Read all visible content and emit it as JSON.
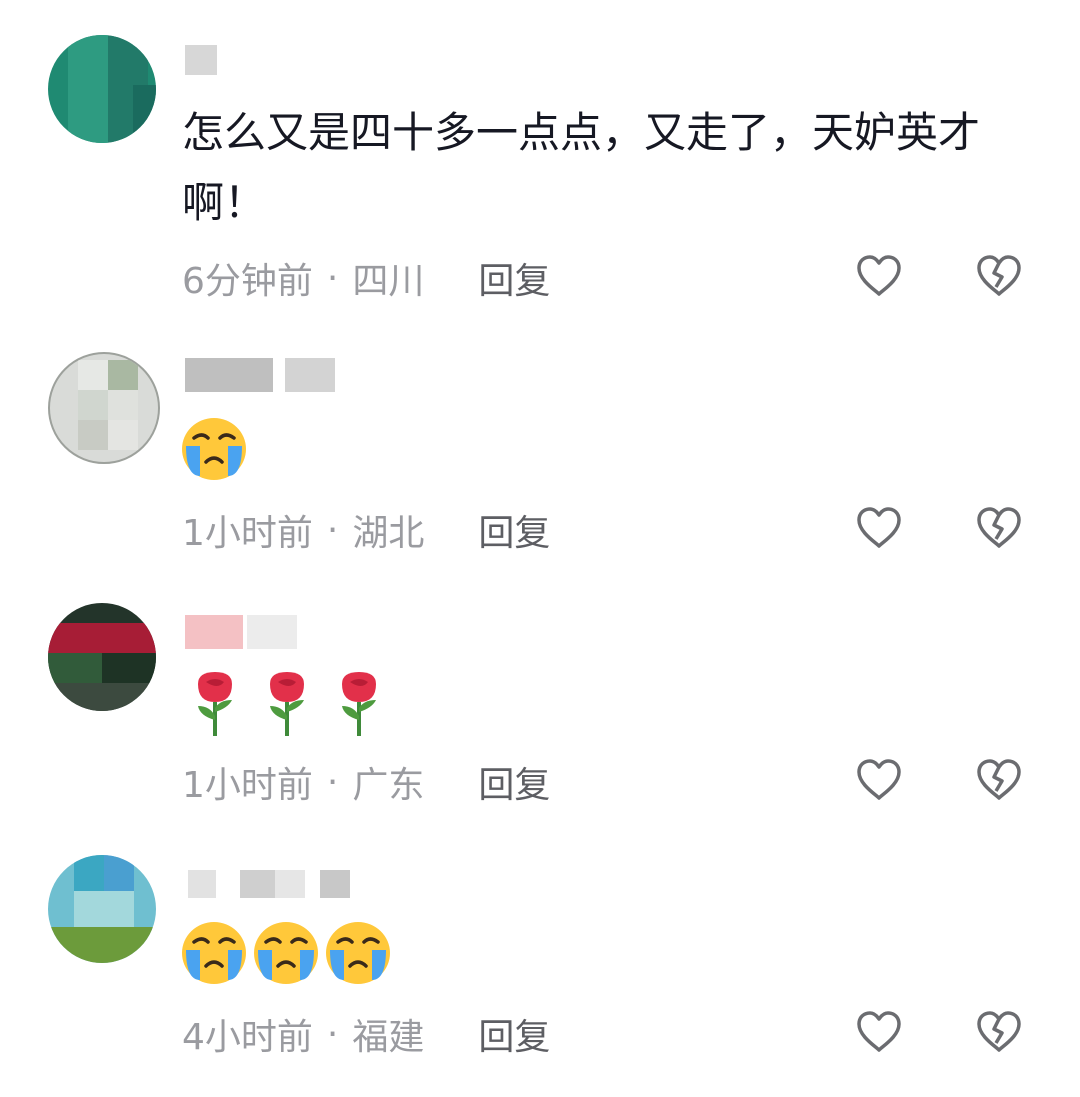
{
  "comments": [
    {
      "text": "怎么又是四十多一点点，又走了，天妒英才啊！",
      "time": "6分钟前",
      "location": "四川",
      "reply": "回复"
    },
    {
      "emoji": [
        "loudly-crying-face"
      ],
      "time": "1小时前",
      "location": "湖北",
      "reply": "回复"
    },
    {
      "emoji": [
        "rose",
        "rose",
        "rose"
      ],
      "time": "1小时前",
      "location": "广东",
      "reply": "回复"
    },
    {
      "emoji": [
        "loudly-crying-face",
        "loudly-crying-face",
        "loudly-crying-face"
      ],
      "time": "4小时前",
      "location": "福建",
      "reply": "回复"
    }
  ],
  "separator": "·",
  "icons": {
    "like": "heart-outline-icon",
    "dislike": "broken-heart-icon"
  },
  "colors": {
    "meta": "#9a9ba0",
    "reply": "#5d5e63",
    "text": "#161823"
  }
}
